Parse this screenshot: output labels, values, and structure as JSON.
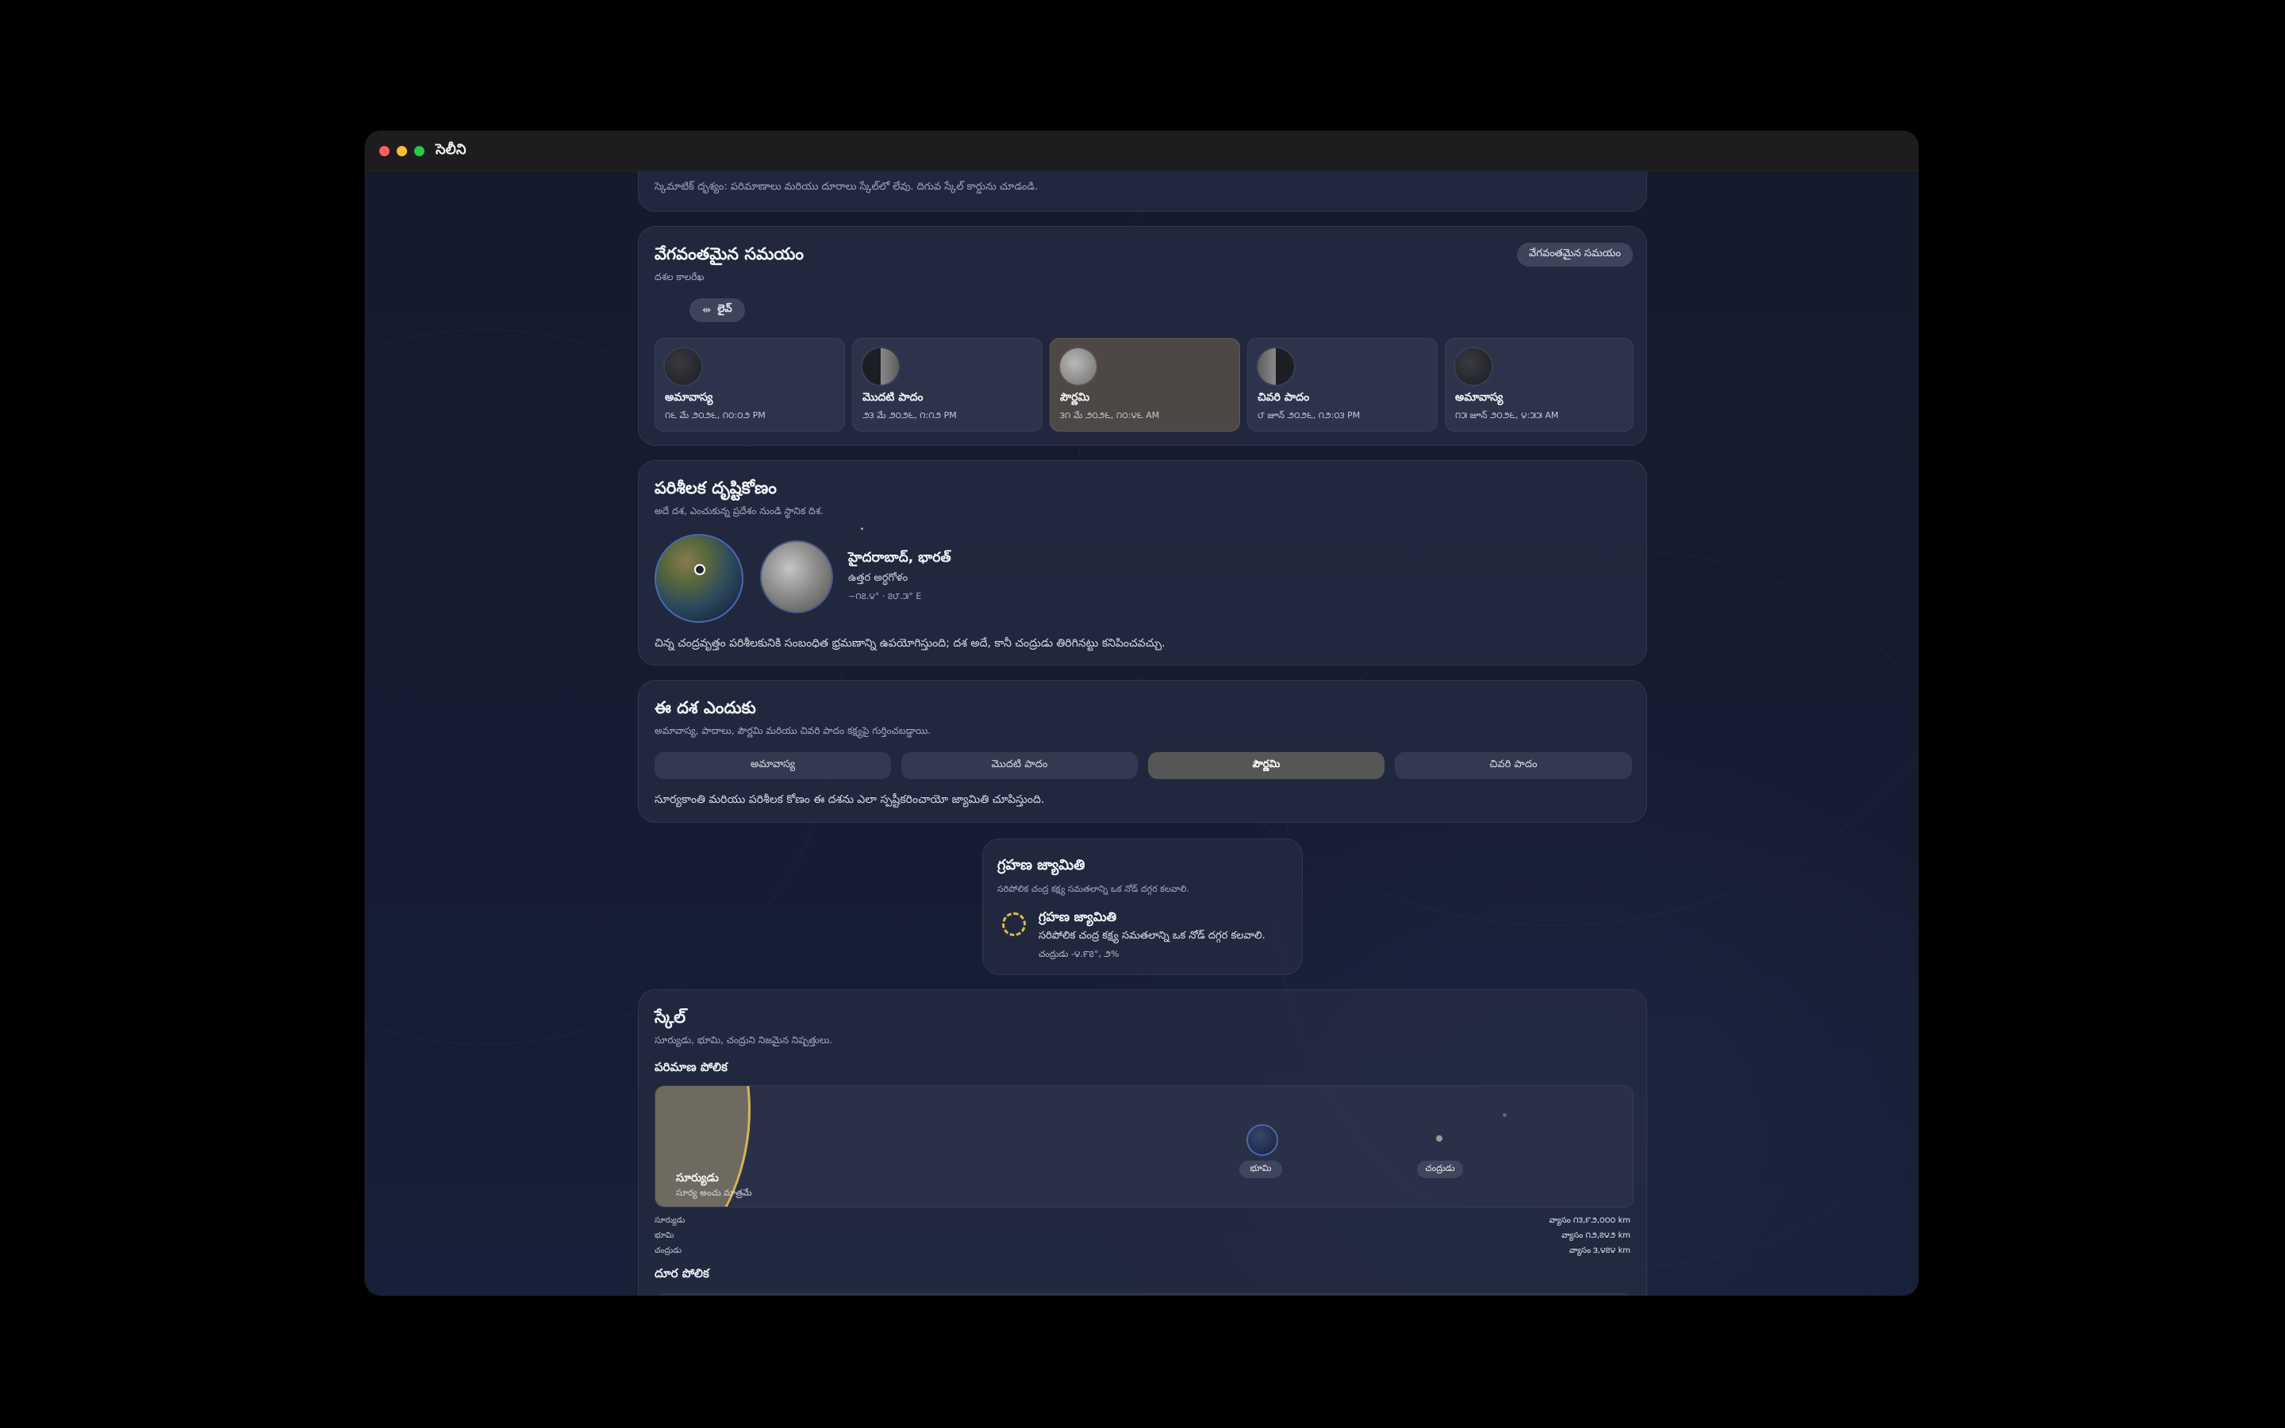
{
  "window": {
    "title": "సెలీని"
  },
  "scale_note": "స్కెమాటిక్ దృశ్యం: పరిమాణాలు మరియు దూరాలు స్కేల్‌లో లేవు. దిగువ స్కేల్ కార్డును చూడండి.",
  "fast_time": {
    "title": "వేగవంతమైన సమయం",
    "subtitle": "దశల కాలరేఖ",
    "badge": "వేగవంతమైన సమయం",
    "live_label": "లైవ్",
    "phases": [
      {
        "name": "అమావాస్య",
        "date": "౧౬ మే ౨౦౨౬, ౧౦:౦౨ PM",
        "icon": "new-moon-icon",
        "active": false
      },
      {
        "name": "మొదటి పాదం",
        "date": "౨౩ మే ౨౦౨౬, ౧:౧౨ PM",
        "icon": "first-quarter-moon-icon",
        "active": false
      },
      {
        "name": "పౌర్ణమి",
        "date": "౩౧ మే ౨౦౨౬, ౧౦:౪౬ AM",
        "icon": "full-moon-icon",
        "active": true
      },
      {
        "name": "చివరి పాదం",
        "date": "౮ జూన్ ౨౦౨౬, ౧౨:౦౩ PM",
        "icon": "last-quarter-moon-icon",
        "active": false
      },
      {
        "name": "అమావాస్య",
        "date": "౧౫ జూన్ ౨౦౨౬, ౪:౫౫ AM",
        "icon": "new-moon-icon",
        "active": false
      }
    ]
  },
  "observer": {
    "title": "పరిశీలక దృష్టికోణం",
    "subtitle": "అదే దశ, ఎంచుకున్న ప్రదేశం నుండి స్థానిక దిశ.",
    "location": "హైదరాబాద్, భారత్",
    "hemisphere": "ఉత్తర అర్ధగోళం",
    "coords": "~౧౭.౪° · ౭౮.౫° E",
    "note": "చిన్న చంద్రవృత్తం పరిశీలకునికి సంబంధిత భ్రమణాన్ని ఉపయోగిస్తుంది; దశ అదే, కానీ చంద్రుడు తిరిగినట్టు కనిపించవచ్చు."
  },
  "why_phase": {
    "title": "ఈ దశ ఎందుకు",
    "subtitle": "అమావాస్య, పాదాలు, పౌర్ణమి మరియు చివరి పాదం కక్ష్యపై గుర్తించబడ్డాయి.",
    "tabs": [
      {
        "label": "అమావాస్య",
        "active": false
      },
      {
        "label": "మొదటి పాదం",
        "active": false
      },
      {
        "label": "పౌర్ణమి",
        "active": true
      },
      {
        "label": "చివరి పాదం",
        "active": false
      }
    ],
    "explanation": "సూర్యకాంతి మరియు పరిశీలక కోణం ఈ దశను ఎలా స్పష్టీకరించాయో జ్యామితి చూపిస్తుంది."
  },
  "eclipse": {
    "title": "గ్రహణ జ్యామితి",
    "subtitle": "సరిపోలిక చంద్ర కక్ష్య సమతలాన్ని ఒక నోడ్ దగ్గర కలవాలి.",
    "item_title": "గ్రహణ జ్యామితి",
    "item_desc": "సరిపోలిక చంద్ర కక్ష్య సమతలాన్ని ఒక నోడ్ దగ్గర కలవాలి.",
    "item_value": "చంద్రుడు -౪.౯౭°, ౨%"
  },
  "scale": {
    "title": "స్కేల్",
    "subtitle": "సూర్యుడు, భూమి, చంద్రుని నిజమైన నిష్పత్తులు.",
    "size_heading": "పరిమాణ పోలిక",
    "sun_label": "సూర్యుడు",
    "sun_sub": "సూర్య అంచు మాత్రమే",
    "earth_label": "భూమి",
    "moon_label": "చంద్రుడు",
    "rows": [
      {
        "name": "సూర్యుడు",
        "value": "వ్యాసం ౧౩,౯౨,౦౦౦ km"
      },
      {
        "name": "భూమి",
        "value": "వ్యాసం ౧౨,౭౪౨ km"
      },
      {
        "name": "చంద్రుడు",
        "value": "వ్యాసం ౩,౪౭౪ km"
      }
    ],
    "distance_heading": "దూర పోలిక"
  },
  "colors": {
    "accent": "#e0b84a",
    "background": "#161b2e",
    "card": "#262c42"
  }
}
